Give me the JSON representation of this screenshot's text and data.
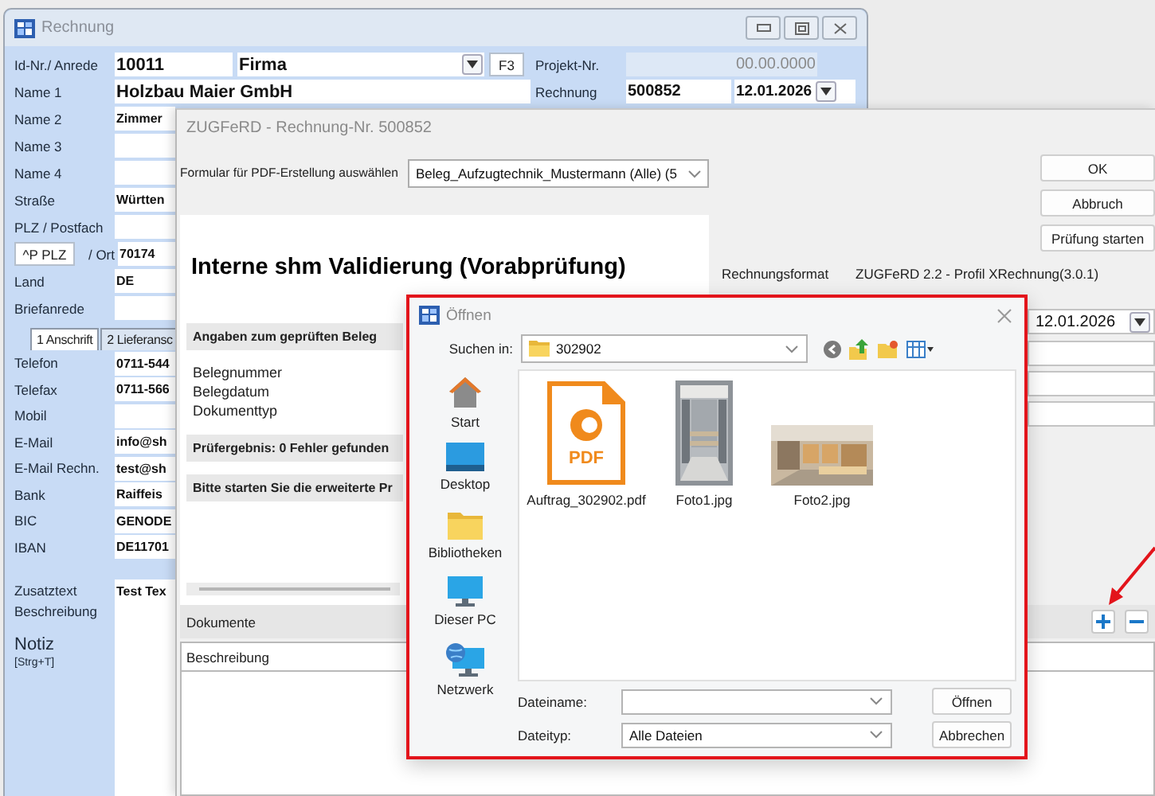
{
  "invoice_window": {
    "title": "Rechnung",
    "id_row": {
      "label": "Id-Nr./ Anrede",
      "id": "10011",
      "salutation": "Firma",
      "key": "F3"
    },
    "rows": [
      {
        "kind": "wide",
        "label": "Name 1",
        "value": "Holzbau Maier GmbH"
      },
      {
        "kind": "narrow",
        "label": "Name 2",
        "value": "Zimmer"
      },
      {
        "kind": "narrow",
        "label": "Name 3"
      },
      {
        "kind": "narrow",
        "label": "Name 4"
      },
      {
        "kind": "narrow",
        "label": "Straße",
        "value": "Württen"
      },
      {
        "kind": "narrow",
        "label": "PLZ / Postfach"
      },
      {
        "kind": "lookup",
        "button": "^P PLZ",
        "label": "/ Ort",
        "value": "70174"
      },
      {
        "kind": "narrow",
        "label": "Land",
        "value": "DE"
      },
      {
        "kind": "narrow",
        "label": "Briefanrede"
      }
    ],
    "tabs": [
      {
        "label": "1 Anschrift",
        "selected": true
      },
      {
        "label": "2 Lieferansc",
        "selected": false
      }
    ],
    "contact_rows": [
      {
        "label": "Telefon",
        "value": "0711-544"
      },
      {
        "label": "Telefax",
        "value": "0711-566"
      },
      {
        "label": "Mobil"
      },
      {
        "label": "E-Mail",
        "value": "info@sh"
      },
      {
        "label": "E-Mail Rechn.",
        "value": "test@sh"
      },
      {
        "label": "Bank",
        "value": "Raiffeis"
      },
      {
        "label": "BIC",
        "value": "GENODE"
      },
      {
        "label": "IBAN",
        "value": "DE11701"
      }
    ],
    "extra_row": {
      "label": "Zusatztext",
      "value": "Test Tex"
    },
    "description": {
      "label": "Beschreibung"
    },
    "note": {
      "label": "Notiz",
      "shortcut": "[Strg+T]"
    },
    "project": {
      "label": "Projekt-Nr.",
      "value": "00.00.0000"
    },
    "invoice": {
      "label": "Rechnung",
      "number": "500852",
      "date": "12.01.2026"
    }
  },
  "zugferd_window": {
    "title": "ZUGFeRD - Rechnung-Nr. 500852",
    "form_label": "Formular für PDF-Erstellung auswählen",
    "form_value": "Beleg_Aufzugtechnik_Mustermann (Alle) (5",
    "buttons": [
      "OK",
      "Abbruch",
      "Prüfung starten"
    ],
    "report": {
      "heading": "Interne shm Validierung (Vorabprüfung)",
      "items": [
        {
          "kind": "band",
          "text": "Angaben zum geprüften Beleg"
        },
        {
          "kind": "line",
          "text": "Belegnummer"
        },
        {
          "kind": "line",
          "text": "Belegdatum"
        },
        {
          "kind": "line",
          "text": "Dokumenttyp"
        },
        {
          "kind": "band",
          "text": "Prüfergebnis: 0 Fehler gefunden"
        },
        {
          "kind": "band",
          "text": "Bitte starten Sie die erweiterte Pr"
        }
      ]
    },
    "format": {
      "label": "Rechnungsformat",
      "value": "ZUGFeRD 2.2 - Profil XRechnung(3.0.1)"
    },
    "date": "12.01.2026",
    "documents": {
      "label": "Dokumente",
      "column": "Beschreibung"
    }
  },
  "open_dialog": {
    "title": "Öffnen",
    "look_in_label": "Suchen in:",
    "folder": "302902",
    "places": [
      {
        "kind": "home",
        "label": "Start"
      },
      {
        "kind": "desktop",
        "label": "Desktop"
      },
      {
        "kind": "folder",
        "label": "Bibliotheken"
      },
      {
        "kind": "computer",
        "label": "Dieser PC"
      },
      {
        "kind": "network",
        "label": "Netzwerk"
      }
    ],
    "files": [
      {
        "kind": "pdf",
        "name": "Auftrag_302902.pdf",
        "icon_text": "PDF"
      },
      {
        "kind": "picture",
        "name": "Foto1.jpg"
      },
      {
        "kind": "picture",
        "name": "Foto2.jpg"
      }
    ],
    "filename_label": "Dateiname:",
    "filetype_label": "Dateityp:",
    "filetype": "Alle Dateien",
    "buttons": [
      "Öffnen",
      "Abbrechen"
    ]
  }
}
